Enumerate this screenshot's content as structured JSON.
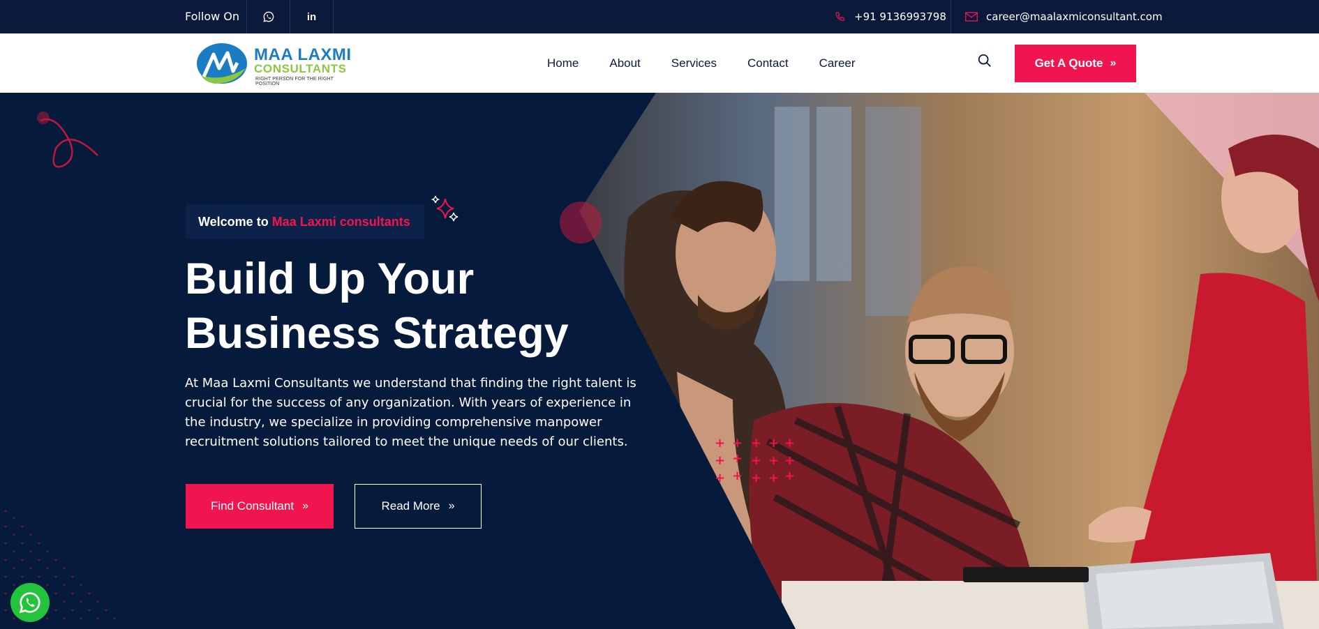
{
  "topbar": {
    "follow_label": "Follow On",
    "social": [
      {
        "icon": "whatsapp-icon"
      },
      {
        "icon": "linkedin-icon",
        "text": "in"
      }
    ],
    "phone": "+91 9136993798",
    "email": "career@maalaxmiconsultant.com"
  },
  "nav": {
    "logo": {
      "line1": "MAA LAXMI",
      "line2": "CONSULTANTS",
      "tagline": "RIGHT PERSON FOR THE RIGHT POSITION"
    },
    "items": [
      {
        "label": "Home"
      },
      {
        "label": "About"
      },
      {
        "label": "Services"
      },
      {
        "label": "Contact"
      },
      {
        "label": "Career"
      }
    ],
    "quote_label": "Get A Quote"
  },
  "hero": {
    "welcome_prefix": "Welcome to",
    "welcome_accent": "Maa Laxmi consultants",
    "headline_line1": "Build Up Your",
    "headline_line2": "Business Strategy",
    "description": "At Maa Laxmi Consultants we understand that finding the right talent is crucial for the success of any organization. With years of experience in the industry, we specialize in providing comprehensive manpower recruitment solutions tailored to meet the unique needs of our clients.",
    "primary_button": "Find Consultant",
    "secondary_button": "Read More"
  },
  "colors": {
    "navy": "#061a3b",
    "topbar": "#0b1a3a",
    "accent": "#f0154f",
    "logo_blue": "#1c7cc3",
    "logo_green": "#8dc63f",
    "whatsapp": "#24c33c"
  }
}
